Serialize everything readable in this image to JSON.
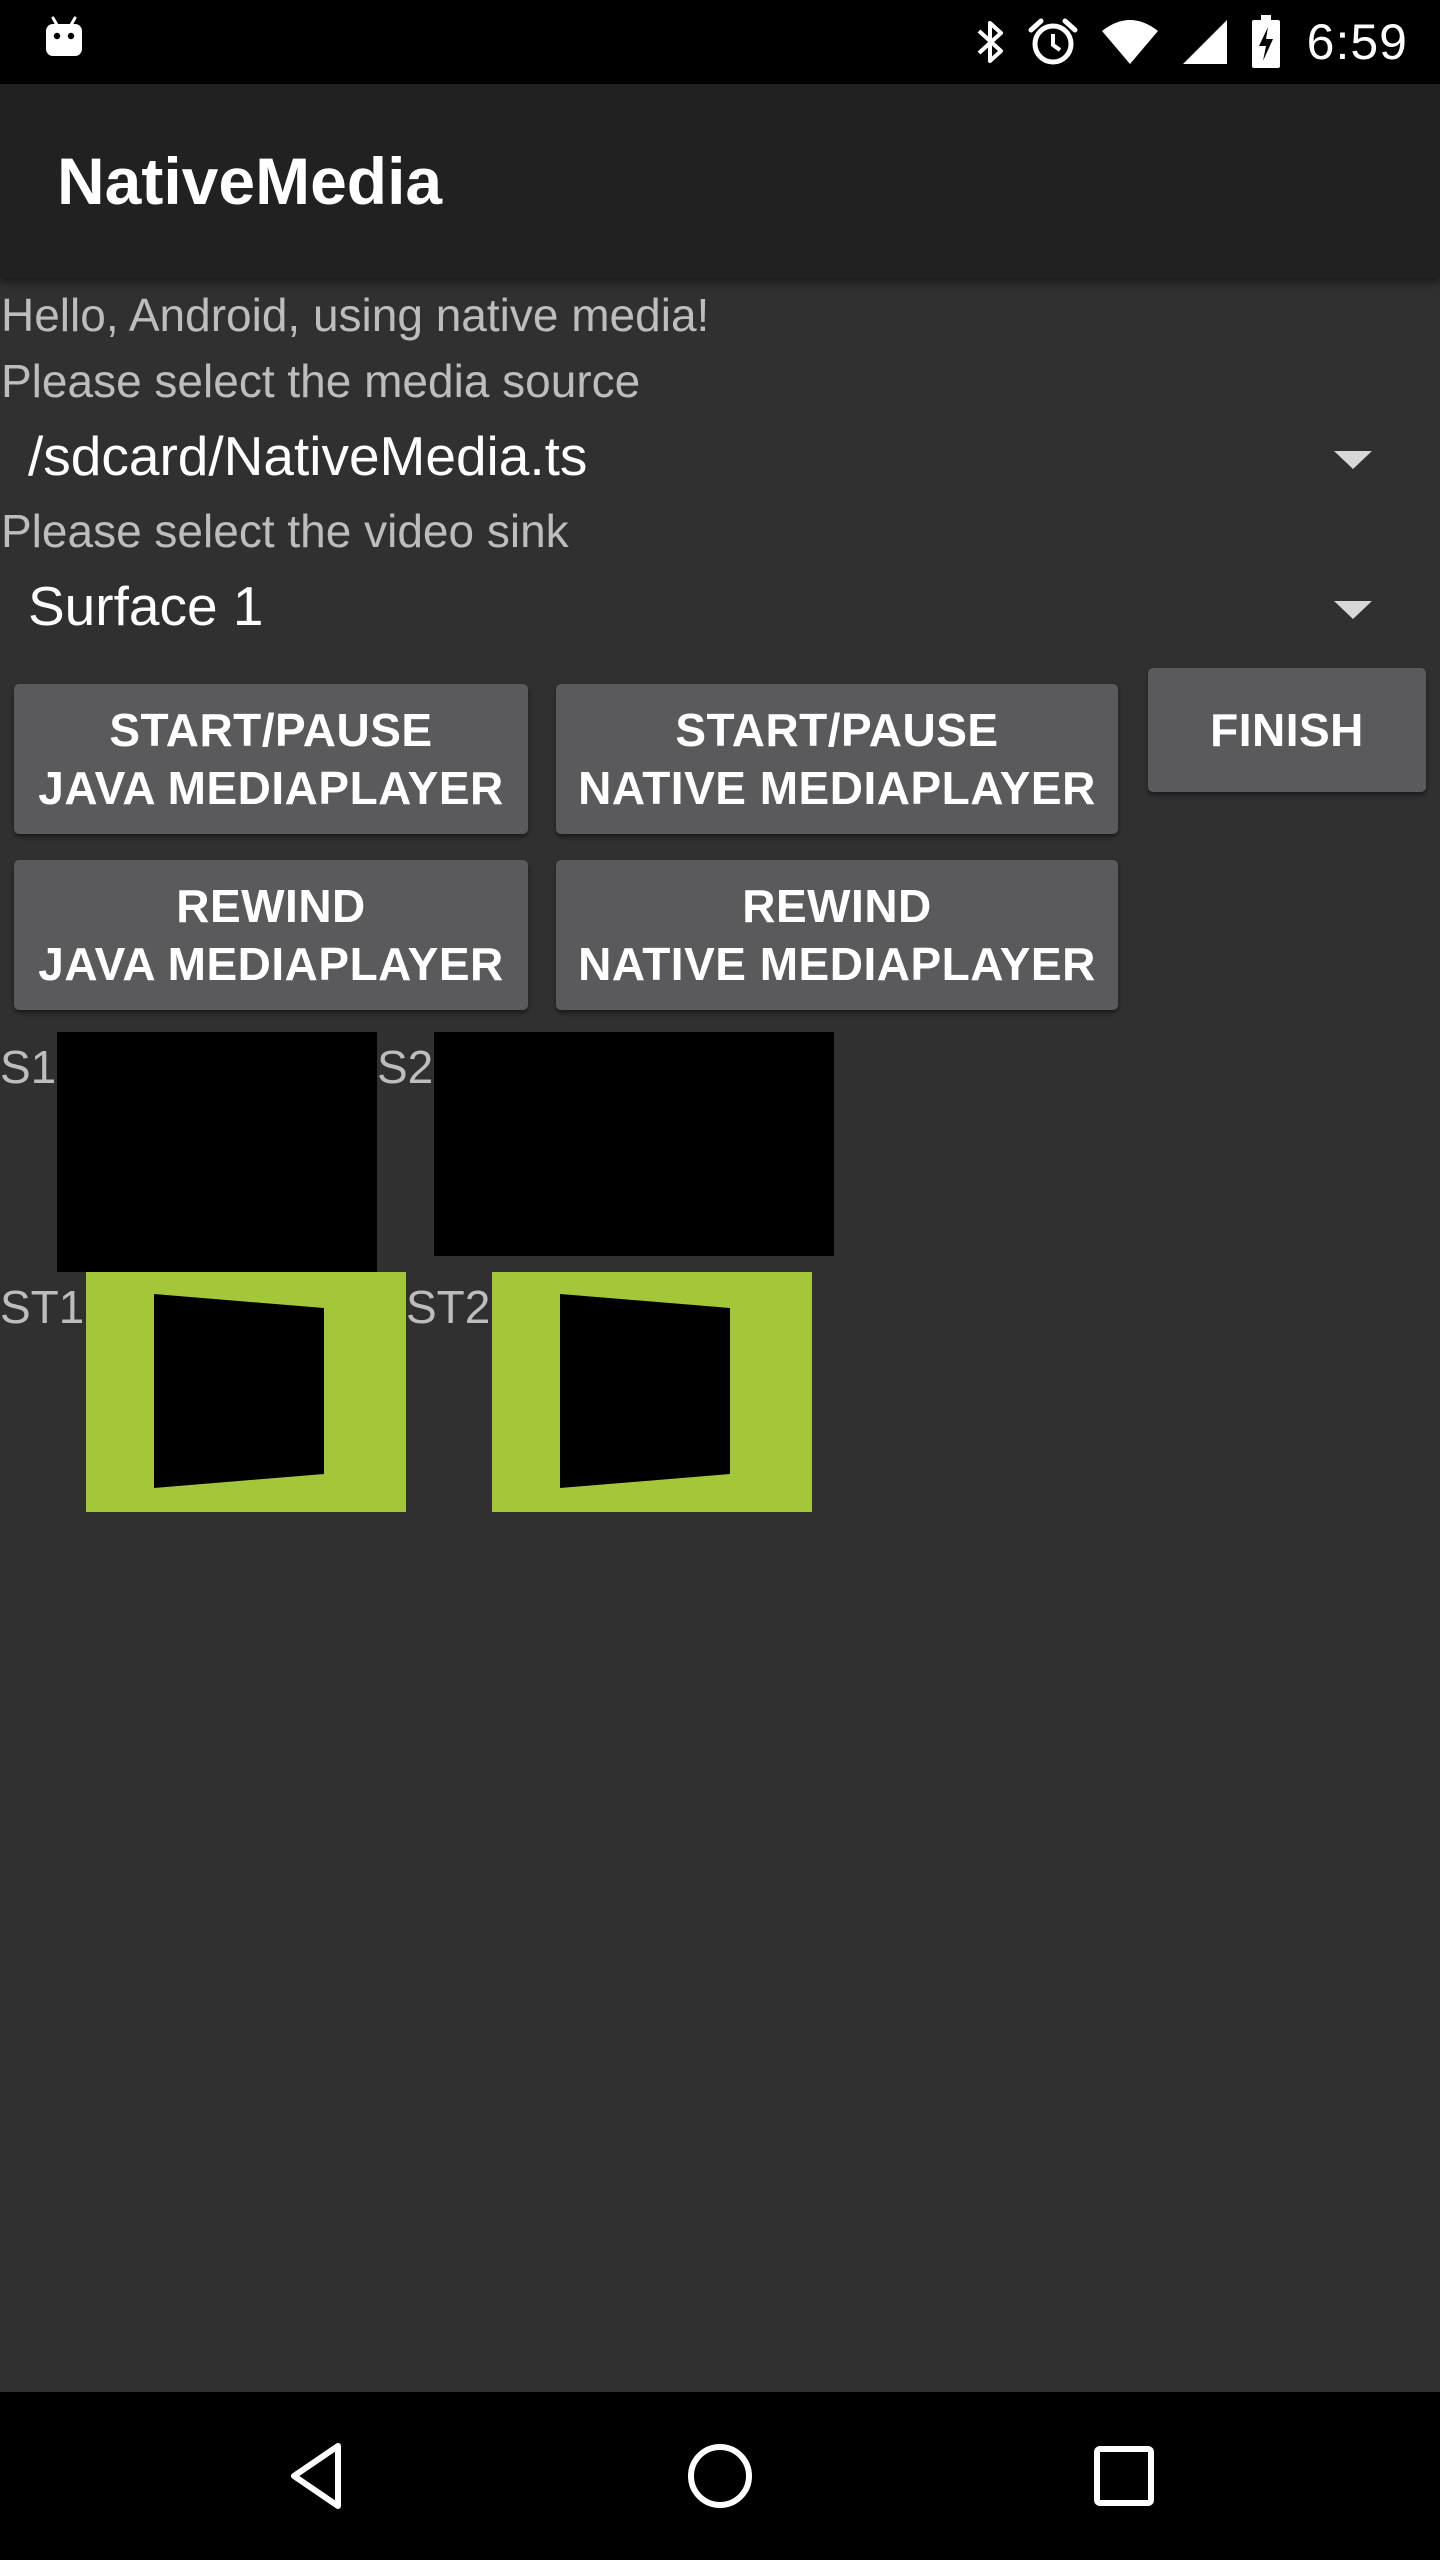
{
  "status_bar": {
    "time": "6:59",
    "icons": [
      "android-robot-icon",
      "bluetooth-icon",
      "alarm-icon",
      "wifi-icon",
      "signal-icon",
      "battery-charging-icon"
    ]
  },
  "action_bar": {
    "title": "NativeMedia"
  },
  "content": {
    "greeting": "Hello, Android, using native media!",
    "source_prompt": "Please select the media source",
    "source_value": "/sdcard/NativeMedia.ts",
    "sink_prompt": "Please select the video sink",
    "sink_value": "Surface 1"
  },
  "buttons": {
    "start_java": [
      "START/PAUSE",
      "JAVA MEDIAPLAYER"
    ],
    "start_native": [
      "START/PAUSE",
      "NATIVE MEDIAPLAYER"
    ],
    "finish": "FINISH",
    "rewind_java": [
      "REWIND",
      "JAVA MEDIAPLAYER"
    ],
    "rewind_native": [
      "REWIND",
      "NATIVE MEDIAPLAYER"
    ]
  },
  "surfaces": {
    "s1": "S1",
    "s2": "S2",
    "st1": "ST1",
    "st2": "ST2"
  },
  "colors": {
    "background": "#303030",
    "action_bar": "#212121",
    "button": "#5a5a5c",
    "texture_green": "#a4c639"
  },
  "nav_bar": {
    "icons": [
      "back-icon",
      "home-icon",
      "recents-icon"
    ]
  }
}
